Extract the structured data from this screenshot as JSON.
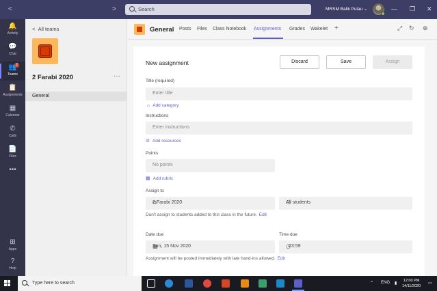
{
  "titlebar": {
    "search_placeholder": "Search",
    "org_name": "MRSM Balik Pulau",
    "chevron": "⌄",
    "back_arrow": "<",
    "forward_arrow": ">",
    "minimize": "—",
    "restore": "❐",
    "close": "✕"
  },
  "rail": {
    "items": [
      {
        "label": "Activity",
        "icon": "bell-icon",
        "glyph": "🔔"
      },
      {
        "label": "Chat",
        "icon": "chat-icon",
        "glyph": "💬"
      },
      {
        "label": "Teams",
        "icon": "teams-icon",
        "glyph": "👥",
        "badge": "2"
      },
      {
        "label": "Assignments",
        "icon": "assignments-icon",
        "glyph": "📋"
      },
      {
        "label": "Calendar",
        "icon": "calendar-icon",
        "glyph": "▦"
      },
      {
        "label": "Calls",
        "icon": "phone-icon",
        "glyph": "✆"
      },
      {
        "label": "Files",
        "icon": "file-icon",
        "glyph": "📄"
      },
      {
        "label": "",
        "icon": "more-icon",
        "glyph": "•••"
      }
    ],
    "bottom": [
      {
        "label": "Apps",
        "icon": "apps-icon",
        "glyph": "⊞"
      },
      {
        "label": "Help",
        "icon": "help-icon",
        "glyph": "?"
      }
    ]
  },
  "team_panel": {
    "back_label": "All teams",
    "back_glyph": "<",
    "team_name": "2 Farabi 2020",
    "more_glyph": "···",
    "channels": [
      "General"
    ]
  },
  "channel_header": {
    "name": "General",
    "tabs": [
      "Posts",
      "Files",
      "Class Notebook",
      "Assignments",
      "Grades",
      "Wakelet"
    ],
    "active_tab": "Assignments",
    "add_glyph": "+",
    "expand_glyph": "⤢",
    "refresh_glyph": "↻",
    "globe_glyph": "⊕"
  },
  "form": {
    "title": "New assignment",
    "discard_label": "Discard",
    "save_label": "Save",
    "assign_label": "Assign",
    "title_label": "Title (required)",
    "title_placeholder": "Enter title",
    "add_category": "Add category",
    "instructions_label": "Instructions",
    "instructions_placeholder": "Enter instructions",
    "add_resources": "Add resources",
    "points_label": "Points",
    "points_placeholder": "No points",
    "add_rubric": "Add rubric",
    "assign_to_label": "Assign to",
    "assign_class": "2 Farabi 2020",
    "assign_students": "All students",
    "assign_note": "Don't assign to students added to this class in the future.",
    "edit_label": "Edit",
    "date_due_label": "Date due",
    "date_due_value": "Sun, 15 Nov 2020",
    "time_due_label": "Time due",
    "time_due_value": "23:59",
    "post_note": "Assignment will be posted immediately with late hand-ins allowed.",
    "post_edit_label": "Edit"
  },
  "taskbar": {
    "search_placeholder": "Type here to search",
    "language": "ENG",
    "time": "12:00 PM",
    "date": "14/11/2020",
    "tray_up": "⌃"
  },
  "colors": {
    "accent": "#5b5fc7",
    "titlebar": "#3d3e66",
    "rail": "#33344a",
    "team_tile": "#ffb75b",
    "team_tile_inner": "#d73b02"
  }
}
